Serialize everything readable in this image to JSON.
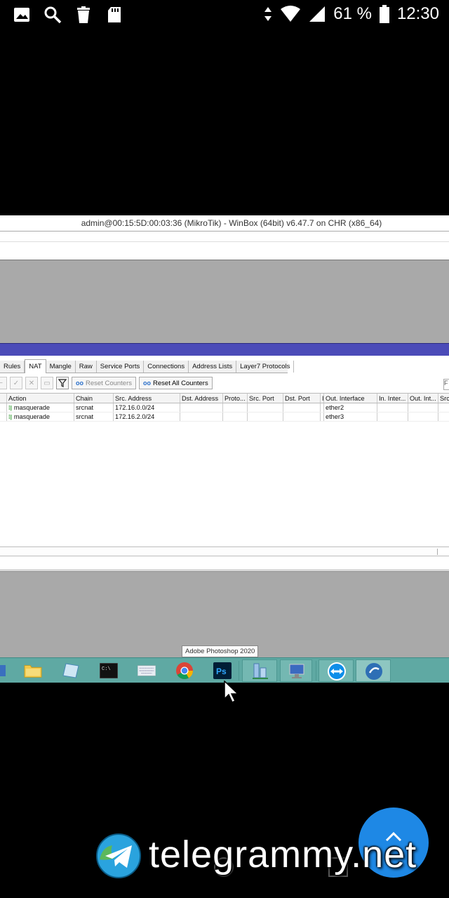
{
  "status_bar": {
    "battery_percent": "61 %",
    "time": "12:30",
    "left_icons": [
      "image-icon",
      "search-icon",
      "trash-icon",
      "sd-card-icon"
    ],
    "right_icons": [
      "data-arrows-icon",
      "wifi-icon",
      "signal-icon",
      "battery-icon"
    ]
  },
  "winbox": {
    "title": "admin@00:15:5D:00:03:36 (MikroTik) - WinBox (64bit) v6.47.7 on CHR (x86_64)",
    "tabs": [
      {
        "label": "Rules",
        "active": false
      },
      {
        "label": "NAT",
        "active": true
      },
      {
        "label": "Mangle",
        "active": false
      },
      {
        "label": "Raw",
        "active": false
      },
      {
        "label": "Service Ports",
        "active": false
      },
      {
        "label": "Connections",
        "active": false
      },
      {
        "label": "Address Lists",
        "active": false
      },
      {
        "label": "Layer7 Protocols",
        "active": false
      }
    ],
    "toolbar": {
      "reset_counters": "Reset Counters",
      "reset_all_counters": "Reset All Counters",
      "find_label": "F"
    },
    "columns": [
      "Action",
      "Chain",
      "Src. Address",
      "Dst. Address",
      "Proto...",
      "Src. Port",
      "Dst. Port",
      "I",
      "Out. Interface",
      "In. Inter...",
      "Out. Int...",
      "Src"
    ],
    "rows": [
      {
        "action": "masquerade",
        "chain": "srcnat",
        "src_address": "172.16.0.0/24",
        "dst_address": "",
        "protocol": "",
        "src_port": "",
        "dst_port": "",
        "in_iface": "",
        "out_interface": "ether2",
        "in_iface_list": "",
        "out_iface_list": "",
        "src_extra": ""
      },
      {
        "action": "masquerade",
        "chain": "srcnat",
        "src_address": "172.16.2.0/24",
        "dst_address": "",
        "protocol": "",
        "src_port": "",
        "dst_port": "",
        "in_iface": "",
        "out_interface": "ether3",
        "in_iface_list": "",
        "out_iface_list": "",
        "src_extra": ""
      }
    ]
  },
  "taskbar": {
    "tooltip": "Adobe Photoshop 2020",
    "items": [
      "folder-icon",
      "notes-icon",
      "terminal-icon",
      "keyboard-icon",
      "chrome-icon",
      "photoshop-icon",
      "network-icon",
      "remote-desktop-icon",
      "teamviewer-icon",
      "winbox-icon"
    ]
  },
  "watermark": {
    "text": "telegrammy.net"
  },
  "colors": {
    "winbox_titlebar": "#4b4bb8",
    "taskbar": "#5fa9a3",
    "fab": "#1e88e5"
  }
}
